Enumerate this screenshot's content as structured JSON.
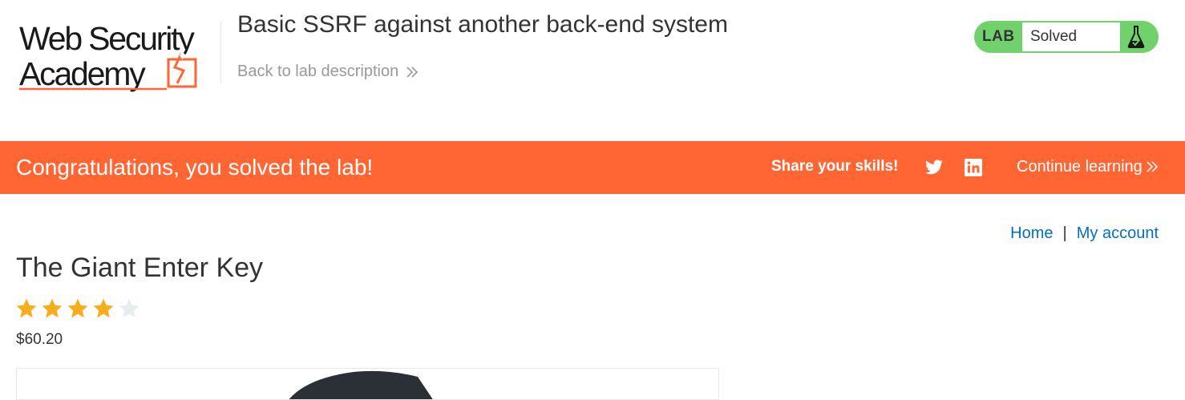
{
  "header": {
    "logo": {
      "line1": "Web Security",
      "line2": "Academy"
    },
    "lab_title": "Basic SSRF against another back-end system",
    "back_link": "Back to lab description",
    "status": {
      "tag": "LAB",
      "value": "Solved"
    }
  },
  "banner": {
    "message": "Congratulations, you solved the lab!",
    "share_label": "Share your skills!",
    "icons": [
      "twitter-icon",
      "linkedin-icon"
    ],
    "continue_label": "Continue learning"
  },
  "nav": {
    "home": "Home",
    "separator": "|",
    "account": "My account"
  },
  "product": {
    "title": "The Giant Enter Key",
    "rating": 4,
    "rating_max": 5,
    "price": "$60.20"
  },
  "colors": {
    "brand_orange": "#ff6633",
    "solved_green": "#70d16d",
    "link_blue": "#0071bc",
    "star_gold": "#f8ad1a",
    "star_empty": "#e7ecee",
    "text_dark": "#333332",
    "text_muted": "#999999"
  }
}
